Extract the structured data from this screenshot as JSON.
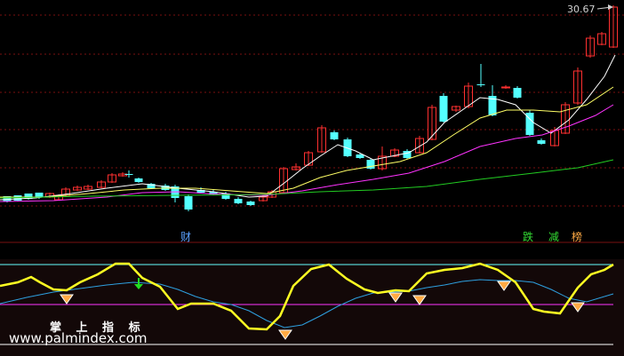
{
  "price_label": "30.67",
  "event_markers": {
    "cai": "财",
    "die": "跌",
    "jian": "减",
    "bang": "榜"
  },
  "watermark": {
    "title": "掌 上 指 标",
    "url": "www.palmindex.com"
  },
  "colors": {
    "bg": "#000000",
    "grid": "#7a1010",
    "bull": "#ff3030",
    "bear": "#54ffff",
    "ma_white": "#ffffff",
    "ma_yellow": "#ffff66",
    "ma_magenta": "#ff33ff",
    "ma_green": "#22cc22",
    "osc_yellow": "#ffff22",
    "osc_blue": "#2ea0e0",
    "osc_magenta": "#ff33ff",
    "osc_band": "#66ffff"
  },
  "icons": {
    "arrow": "arrow-icon",
    "diamond": "diamond-icon",
    "down_arrow": "down-arrow-icon"
  }
}
